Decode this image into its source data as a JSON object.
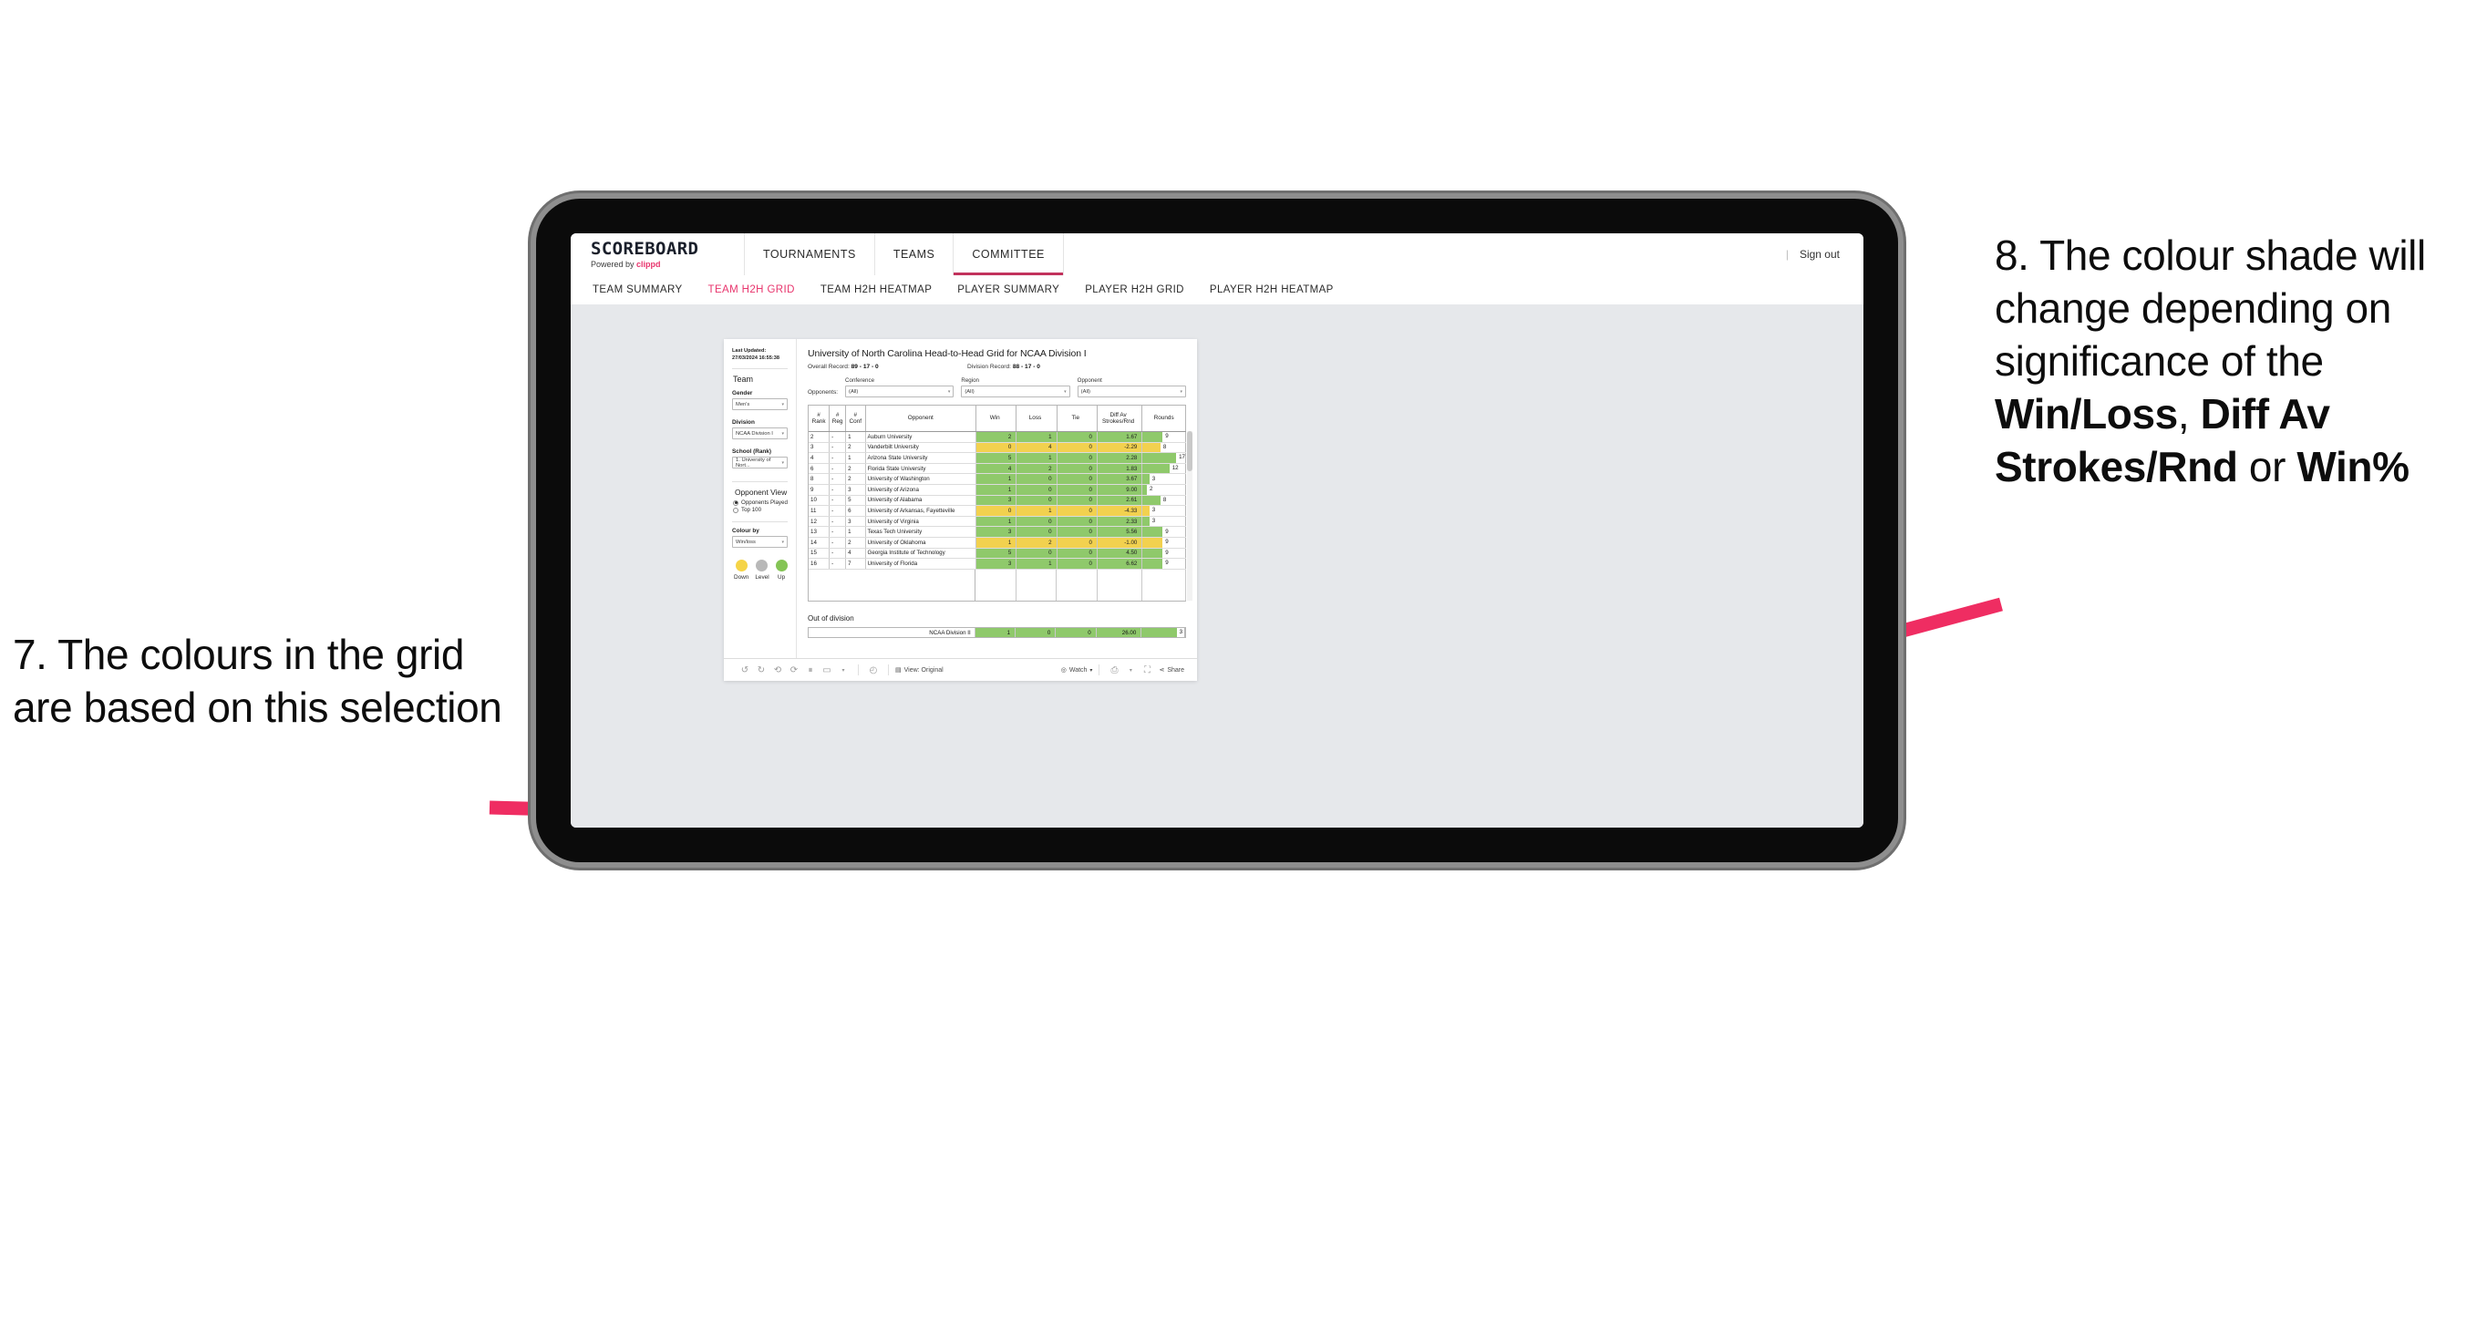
{
  "annotations": {
    "left": "7. The colours in the grid are based on this selection",
    "right_pre": "8. The colour shade will change depending on significance of the ",
    "right_b1": "Win/Loss",
    "right_mid1": ", ",
    "right_b2": "Diff Av Strokes/Rnd",
    "right_mid2": " or ",
    "right_b3": "Win%",
    "arrow_color": "#ef2d62"
  },
  "app": {
    "brand_name": "SCOREBOARD",
    "brand_sub_prefix": "Powered by ",
    "brand_sub_brand": "clippd",
    "nav": [
      {
        "label": "TOURNAMENTS",
        "active": false
      },
      {
        "label": "TEAMS",
        "active": false
      },
      {
        "label": "COMMITTEE",
        "active": true
      }
    ],
    "sign_out": "Sign out",
    "divider": "|",
    "subnav": [
      {
        "label": "TEAM SUMMARY",
        "active": false
      },
      {
        "label": "TEAM H2H GRID",
        "active": true
      },
      {
        "label": "TEAM H2H HEATMAP",
        "active": false
      },
      {
        "label": "PLAYER SUMMARY",
        "active": false
      },
      {
        "label": "PLAYER H2H GRID",
        "active": false
      },
      {
        "label": "PLAYER H2H HEATMAP",
        "active": false
      }
    ]
  },
  "sidebar": {
    "last_updated": "Last Updated: 27/03/2024 16:55:38",
    "team_heading": "Team",
    "gender_label": "Gender",
    "gender_value": "Men's",
    "division_label": "Division",
    "division_value": "NCAA Division I",
    "school_label": "School (Rank)",
    "school_value": "1. University of Nort...",
    "opponent_view_heading": "Opponent View",
    "opponent_view_options": [
      {
        "label": "Opponents Played",
        "selected": true
      },
      {
        "label": "Top 100",
        "selected": false
      }
    ],
    "colour_by_label": "Colour by",
    "colour_by_value": "Win/loss",
    "legend": [
      {
        "label": "Down",
        "color": "#f5d447"
      },
      {
        "label": "Level",
        "color": "#b8b8b8"
      },
      {
        "label": "Up",
        "color": "#84c455"
      }
    ]
  },
  "viz": {
    "title": "University of North Carolina Head-to-Head Grid for NCAA Division I",
    "overall_record_label": "Overall Record: ",
    "overall_record_value": "89 - 17 - 0",
    "division_record_label": "Division Record: ",
    "division_record_value": "88 - 17 - 0",
    "opponents_label": "Opponents:",
    "filters": [
      {
        "label": "Conference",
        "value": "(All)"
      },
      {
        "label": "Region",
        "value": "(All)"
      },
      {
        "label": "Opponent",
        "value": "(All)"
      }
    ],
    "out_of_division_heading": "Out of division",
    "out_of_division_row": {
      "name": "NCAA Division II",
      "win": "1",
      "loss": "0",
      "tie": "0",
      "diff": "26.00",
      "rounds": "3",
      "color": "#8fc96b",
      "bar_pct": 82
    }
  },
  "chart_data": {
    "type": "table",
    "title": "University of North Carolina Head-to-Head Grid for NCAA Division I",
    "columns": [
      "# Rank",
      "# Reg",
      "# Conf",
      "Opponent",
      "Win",
      "Loss",
      "Tie",
      "Diff Av Strokes/Rnd",
      "Rounds"
    ],
    "column_header_lines": [
      [
        "#",
        "Rank"
      ],
      [
        "#",
        "Reg"
      ],
      [
        "#",
        "Conf"
      ],
      [
        "Opponent"
      ],
      [
        "Win"
      ],
      [
        "Loss"
      ],
      [
        "Tie"
      ],
      [
        "Diff Av",
        "Strokes/Rnd"
      ],
      [
        "Rounds"
      ]
    ],
    "colors": {
      "up": "#8fc96b",
      "down": "#f2d14f",
      "level": "#b8b8b8"
    },
    "rounds_max": 17,
    "rows": [
      {
        "rank": "2",
        "reg": "-",
        "conf": "1",
        "opponent": "Auburn University",
        "win": "2",
        "loss": "1",
        "tie": "0",
        "diff": "1.67",
        "rounds": "9",
        "color": "#8fc96b",
        "bar_pct": 47
      },
      {
        "rank": "3",
        "reg": "-",
        "conf": "2",
        "opponent": "Vanderbilt University",
        "win": "0",
        "loss": "4",
        "tie": "0",
        "diff": "-2.29",
        "rounds": "8",
        "color": "#f2d14f",
        "bar_pct": 42
      },
      {
        "rank": "4",
        "reg": "-",
        "conf": "1",
        "opponent": "Arizona State University",
        "win": "5",
        "loss": "1",
        "tie": "0",
        "diff": "2.28",
        "rounds": "17",
        "color": "#8fc96b",
        "bar_pct": 89
      },
      {
        "rank": "6",
        "reg": "-",
        "conf": "2",
        "opponent": "Florida State University",
        "win": "4",
        "loss": "2",
        "tie": "0",
        "diff": "1.83",
        "rounds": "12",
        "color": "#8fc96b",
        "bar_pct": 63
      },
      {
        "rank": "8",
        "reg": "-",
        "conf": "2",
        "opponent": "University of Washington",
        "win": "1",
        "loss": "0",
        "tie": "0",
        "diff": "3.67",
        "rounds": "3",
        "color": "#8fc96b",
        "bar_pct": 16
      },
      {
        "rank": "9",
        "reg": "-",
        "conf": "3",
        "opponent": "University of Arizona",
        "win": "1",
        "loss": "0",
        "tie": "0",
        "diff": "9.00",
        "rounds": "2",
        "color": "#8fc96b",
        "bar_pct": 10
      },
      {
        "rank": "10",
        "reg": "-",
        "conf": "5",
        "opponent": "University of Alabama",
        "win": "3",
        "loss": "0",
        "tie": "0",
        "diff": "2.61",
        "rounds": "8",
        "color": "#8fc96b",
        "bar_pct": 42
      },
      {
        "rank": "11",
        "reg": "-",
        "conf": "6",
        "opponent": "University of Arkansas, Fayetteville",
        "win": "0",
        "loss": "1",
        "tie": "0",
        "diff": "-4.33",
        "rounds": "3",
        "color": "#f2d14f",
        "bar_pct": 16
      },
      {
        "rank": "12",
        "reg": "-",
        "conf": "3",
        "opponent": "University of Virginia",
        "win": "1",
        "loss": "0",
        "tie": "0",
        "diff": "2.33",
        "rounds": "3",
        "color": "#8fc96b",
        "bar_pct": 16
      },
      {
        "rank": "13",
        "reg": "-",
        "conf": "1",
        "opponent": "Texas Tech University",
        "win": "3",
        "loss": "0",
        "tie": "0",
        "diff": "5.56",
        "rounds": "9",
        "color": "#8fc96b",
        "bar_pct": 47
      },
      {
        "rank": "14",
        "reg": "-",
        "conf": "2",
        "opponent": "University of Oklahoma",
        "win": "1",
        "loss": "2",
        "tie": "0",
        "diff": "-1.00",
        "rounds": "9",
        "color": "#f2d14f",
        "bar_pct": 47
      },
      {
        "rank": "15",
        "reg": "-",
        "conf": "4",
        "opponent": "Georgia Institute of Technology",
        "win": "5",
        "loss": "0",
        "tie": "0",
        "diff": "4.50",
        "rounds": "9",
        "color": "#8fc96b",
        "bar_pct": 47
      },
      {
        "rank": "16",
        "reg": "-",
        "conf": "7",
        "opponent": "University of Florida",
        "win": "3",
        "loss": "1",
        "tie": "0",
        "diff": "6.62",
        "rounds": "9",
        "color": "#8fc96b",
        "bar_pct": 47
      }
    ]
  },
  "toolbar": {
    "icons": [
      "undo-icon",
      "redo-icon",
      "revert-icon",
      "refresh-icon",
      "pause-icon",
      "alerts-dropdown-icon",
      "caret-icon",
      "separator",
      "clock-icon",
      "separator2",
      "view-icon"
    ],
    "view_label": "View: Original",
    "watch_label": "Watch",
    "share_label": "Share"
  }
}
